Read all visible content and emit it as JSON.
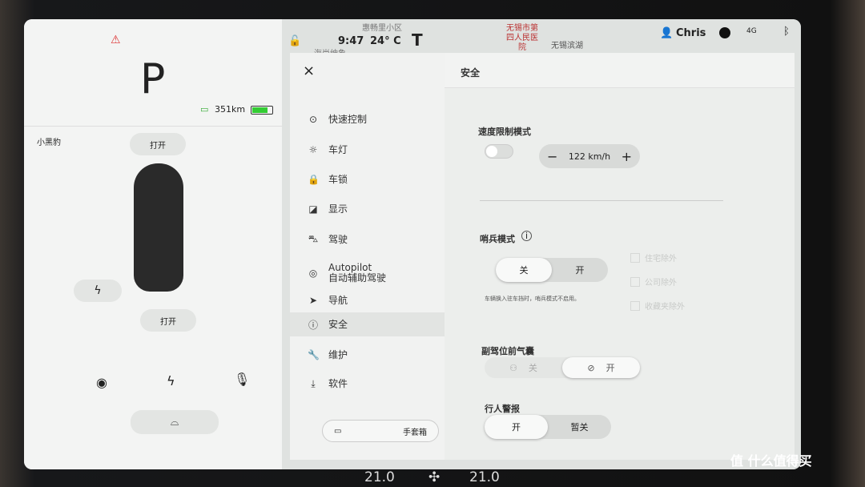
{
  "status": {
    "time": "9:47",
    "temperature": "24° C",
    "user": "Chris",
    "network": "4G"
  },
  "map_labels": [
    "惠畅里小区",
    "海尚绅象",
    "无锡市第四人民医院",
    "无锡滨湖"
  ],
  "vehicle": {
    "gear": "P",
    "range": "351km",
    "battery_percent": 80,
    "name": "小黑豹",
    "frunk_label": "打开",
    "trunk_label": "打开"
  },
  "menu": {
    "close": "×",
    "items": [
      {
        "icon": "toggle-icon",
        "label": "快速控制"
      },
      {
        "icon": "light-icon",
        "label": "车灯"
      },
      {
        "icon": "lock-icon",
        "label": "车锁"
      },
      {
        "icon": "display-icon",
        "label": "显示"
      },
      {
        "icon": "car-icon",
        "label": "驾驶"
      },
      {
        "icon": "steering-icon",
        "label": "Autopilot",
        "sub": "自动辅助驾驶"
      },
      {
        "icon": "navigation-icon",
        "label": "导航"
      },
      {
        "icon": "alert-icon",
        "label": "安全",
        "selected": true
      },
      {
        "icon": "wrench-icon",
        "label": "维护"
      },
      {
        "icon": "download-icon",
        "label": "软件"
      }
    ],
    "glovebox": "手套箱"
  },
  "content": {
    "title": "安全",
    "speed_limit": {
      "label": "速度限制模式",
      "enabled": false,
      "value": "122 km/h",
      "minus": "−",
      "plus": "+"
    },
    "sentry": {
      "label": "哨兵模式",
      "options": [
        "关",
        "开"
      ],
      "selected": "关",
      "note": "车辆换入驻车挡时，哨兵模式不启用。",
      "exclusions": [
        "住宅除外",
        "公司除外",
        "收藏夹除外"
      ]
    },
    "airbag": {
      "label": "副驾位前气囊",
      "options": [
        "关",
        "开"
      ],
      "selected": "开"
    },
    "pedestrian": {
      "label": "行人警报",
      "options": [
        "开",
        "暂关"
      ],
      "selected": "开"
    }
  },
  "climate": {
    "left_temp": "21.0",
    "right_temp": "21.0"
  },
  "watermark": "值 什么值得买"
}
